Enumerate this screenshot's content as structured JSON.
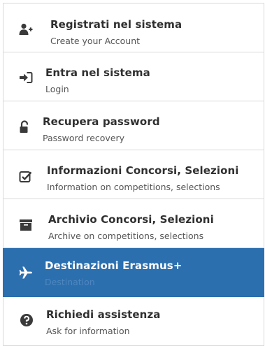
{
  "menu": {
    "items": [
      {
        "icon": "user-plus-icon",
        "title": "Registrati nel sistema",
        "subtitle": "Create your Account"
      },
      {
        "icon": "sign-in-icon",
        "title": "Entra nel sistema",
        "subtitle": "Login"
      },
      {
        "icon": "unlock-icon",
        "title": "Recupera password",
        "subtitle": "Password recovery"
      },
      {
        "icon": "checkbox-icon",
        "title": "Informazioni Concorsi, Selezioni",
        "subtitle": "Information on competitions, selections"
      },
      {
        "icon": "archive-icon",
        "title": "Archivio Concorsi, Selezioni",
        "subtitle": "Archive on competitions, selections"
      },
      {
        "icon": "plane-icon",
        "title": "Destinazioni Erasmus+",
        "subtitle": "Destination",
        "active": true
      },
      {
        "icon": "question-circle-icon",
        "title": "Richiedi assistenza",
        "subtitle": "Ask for information"
      }
    ]
  },
  "colors": {
    "active_background": "#2b6faf",
    "border": "#d9d9d9",
    "text": "#2f2f2f",
    "subtext": "#555555"
  }
}
